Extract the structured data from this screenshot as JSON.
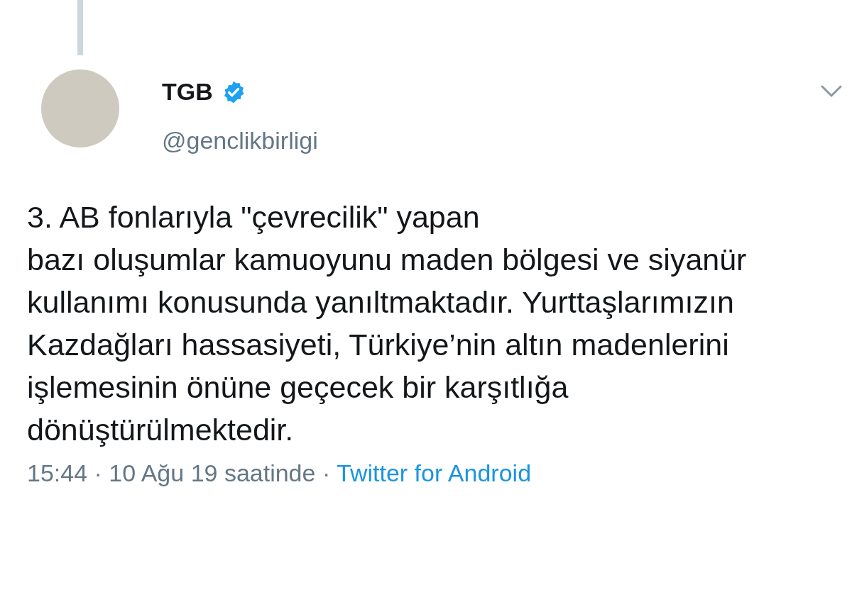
{
  "tweet": {
    "author": {
      "name": "TGB",
      "verified": true,
      "handle": "@genclikbirligi"
    },
    "text": "3. AB fonlarıyla \"çevrecilik\" yapan\nbazı oluşumlar kamuoyunu maden bölgesi ve siyanür kullanımı konusunda yanıltmaktadır. Yurttaşlarımızın Kazdağları hassasiyeti, Türkiye’nin altın madenlerini işlemesinin önüne geçecek bir karşıtlığa dönüştürülmektedir.",
    "meta": "15:44 · 10 Ağu 19 saatinde · ",
    "source": "Twitter for Android"
  }
}
